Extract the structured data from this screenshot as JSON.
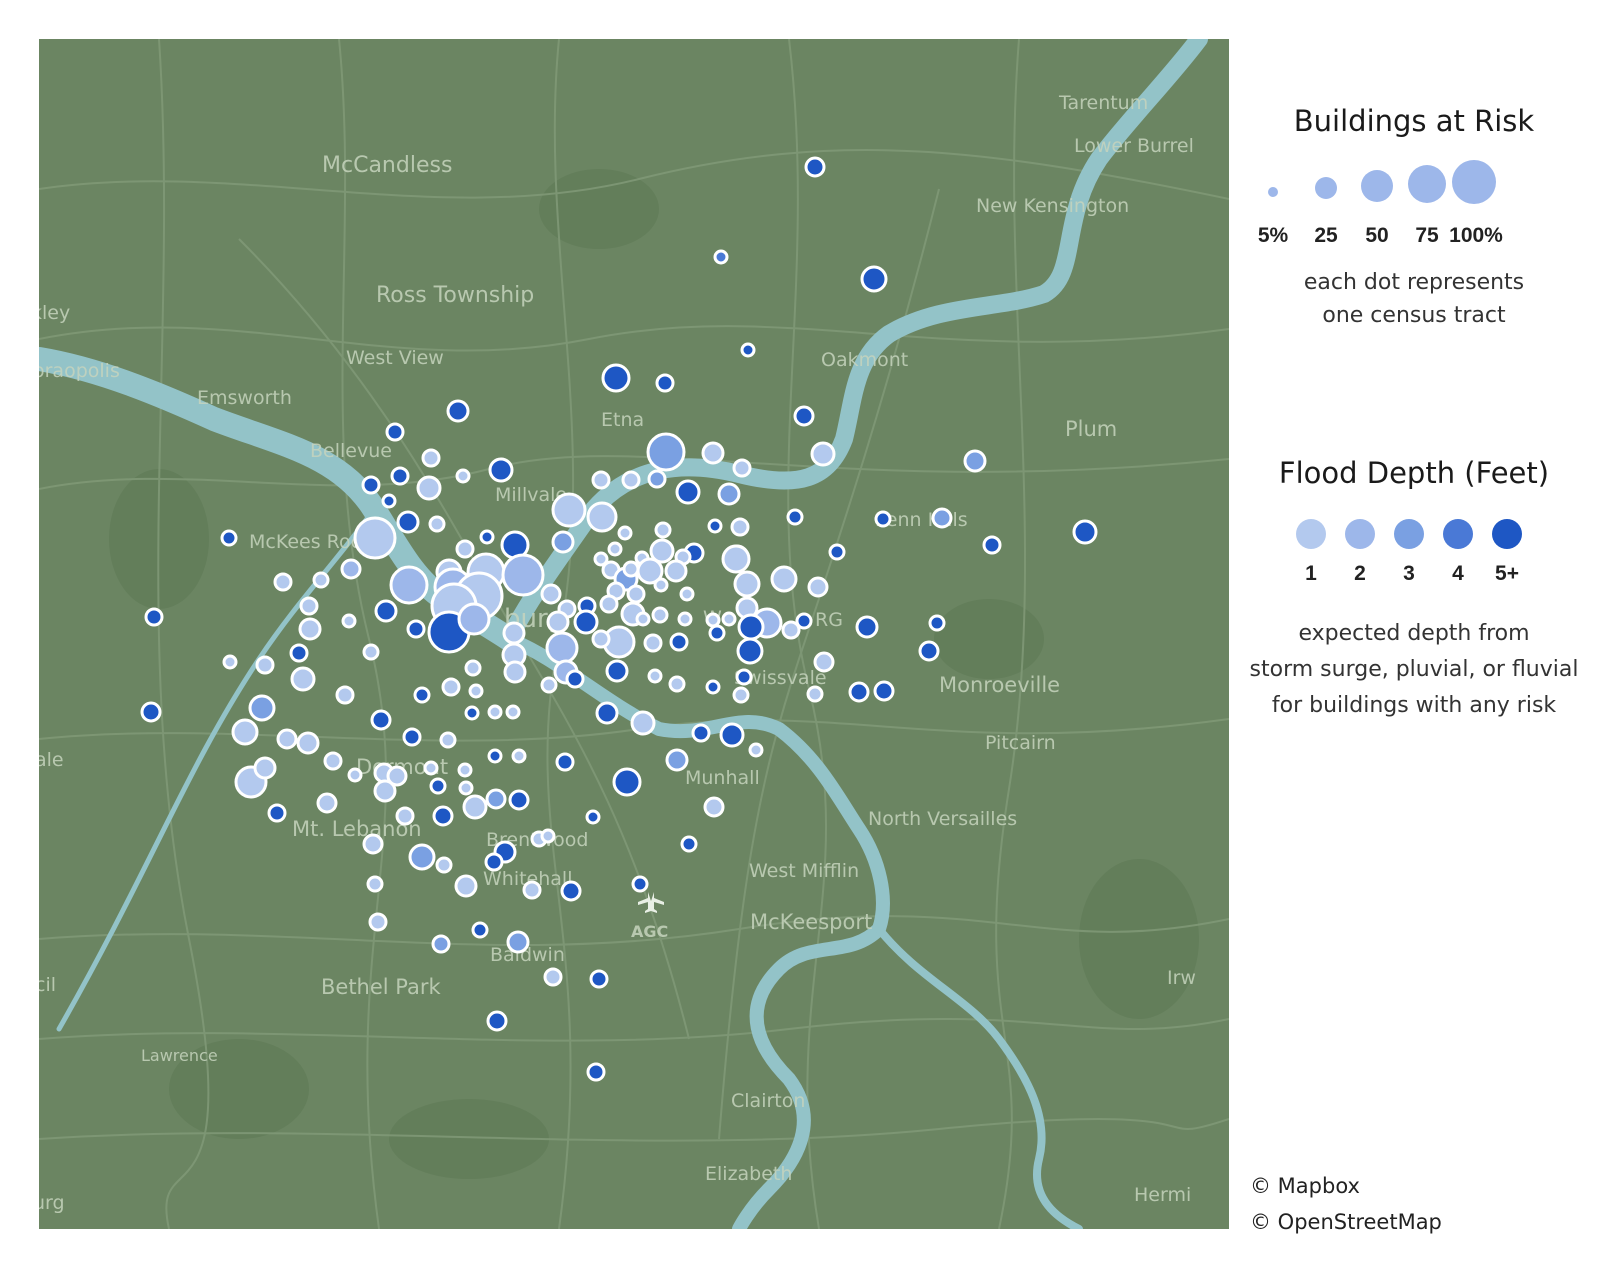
{
  "map": {
    "places": [
      "Tarentum",
      "Lower Burrel",
      "McCandless",
      "New Kensington",
      "Ross Township",
      "kley",
      "West View",
      "oraopolis",
      "Oakmont",
      "Emsworth",
      "Etna",
      "Plum",
      "Bellevue",
      "Millvale",
      "McKees Rock",
      "Penn Hills",
      "burg",
      "W",
      "RG",
      "Swissvale",
      "Monroeville",
      "ale",
      "Dormont",
      "Munhall",
      "Pitcairn",
      "Mt. Lebanon",
      "North Versailles",
      "Brentwood",
      "West Mifflin",
      "Whitehall",
      "McKeesport",
      "AGC",
      "Baldwin",
      "cil",
      "Irw",
      "Bethel Park",
      "Lawrence",
      "Clairton",
      "urg",
      "Elizabeth",
      "Hermi"
    ],
    "airport_icon": "airplane-icon",
    "colors": {
      "land": "#6b8562",
      "water": "#93c3c8",
      "roads": "#7f9876",
      "labels": "#c5d3bd"
    }
  },
  "legend": {
    "size": {
      "title": "Buildings at Risk",
      "labels": [
        "5%",
        "25",
        "50",
        "75",
        "100%"
      ],
      "note_line1": "each dot represents",
      "note_line2": "one census tract"
    },
    "depth": {
      "title": "Flood Depth (Feet)",
      "labels": [
        "1",
        "2",
        "3",
        "4",
        "5+"
      ],
      "colors": [
        "#b3c9ee",
        "#9db7ea",
        "#7aa0e2",
        "#4a79d6",
        "#1e57c4"
      ],
      "note_line1": "expected depth from",
      "note_line2": "storm surge, pluvial, or fluvial",
      "note_line3": "for buildings with any risk"
    }
  },
  "attribution": {
    "mapbox": "© Mapbox",
    "osm": "© OpenStreetMap"
  }
}
